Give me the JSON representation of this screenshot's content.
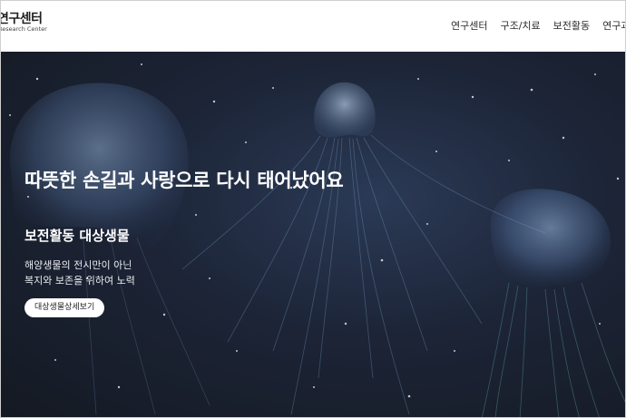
{
  "header": {
    "logo_text": "연구센터",
    "logo_subtext": "Research Center",
    "nav": [
      "연구센터",
      "구조/치료",
      "보전활동",
      "연구과제"
    ]
  },
  "hero": {
    "headline": "따뜻한 손길과 사랑으로 다시 태어났어요",
    "subtitle": "보전활동 대상생물",
    "description": [
      "해양생물의 전시만이 아닌",
      "복지와 보존을 위하여 노력"
    ],
    "button_label": "대상생물상세보기"
  },
  "colors": {
    "background": "#1c2436",
    "jellyfish_glow": "#7fa8d8",
    "button_bg": "#ffffff"
  }
}
